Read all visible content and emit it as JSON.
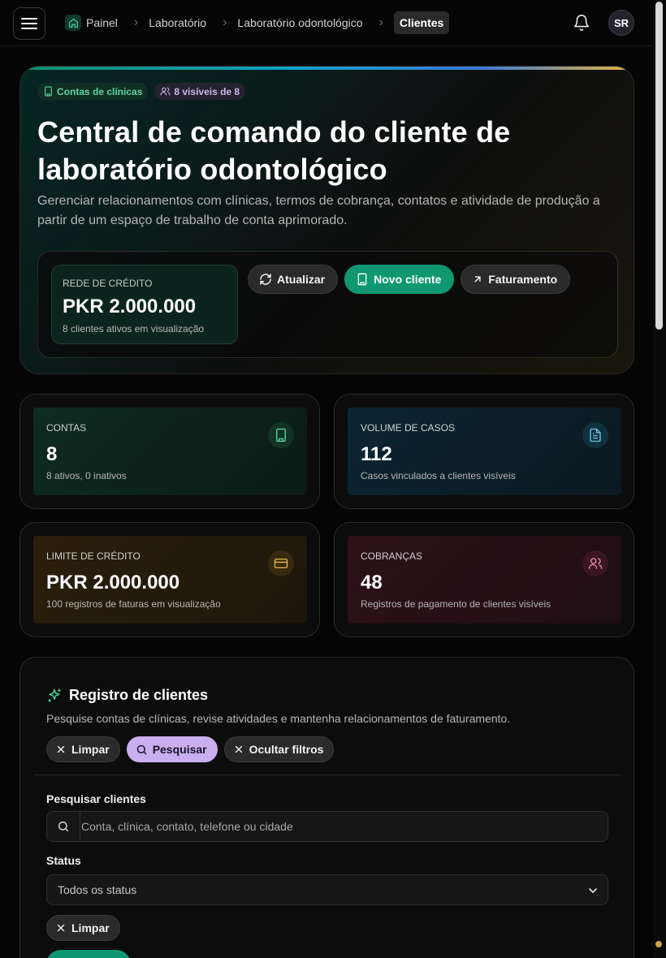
{
  "topbar": {
    "breadcrumbs": [
      "Painel",
      "Laboratório",
      "Laboratório odontológico",
      "Clientes"
    ],
    "avatar_initials": "SR"
  },
  "hero": {
    "chip_accounts": "Contas de clínicas",
    "chip_visible": "8 visíveis de 8",
    "title": "Central de comando do cliente de laboratório odontológico",
    "description": "Gerenciar relacionamentos com clínicas, termos de cobrança, contatos e atividade de produção a partir de um espaço de trabalho de conta aprimorado.",
    "credit": {
      "label": "Rede de crédito",
      "value": "PKR 2.000.000",
      "sub": "8 clientes ativos em visualização"
    },
    "actions": {
      "refresh": "Atualizar",
      "new_client": "Novo cliente",
      "billing": "Faturamento"
    }
  },
  "stats": [
    {
      "label": "Contas",
      "value": "8",
      "sub": "8 ativos, 0 inativos",
      "icon": "building-icon",
      "color": "#5fd6a2"
    },
    {
      "label": "Volume de casos",
      "value": "112",
      "sub": "Casos vinculados a clientes visíveis",
      "icon": "file-text-icon",
      "color": "#6cc6ec"
    },
    {
      "label": "Limite de crédito",
      "value": "PKR 2.000.000",
      "sub": "100 registros de faturas em visualização",
      "icon": "credit-card-icon",
      "color": "#e7b84a"
    },
    {
      "label": "Cobranças",
      "value": "48",
      "sub": "Registros de pagamento de clientes visíveis",
      "icon": "users-icon",
      "color": "#e88fa4"
    }
  ],
  "registry": {
    "title": "Registro de clientes",
    "description": "Pesquise contas de clínicas, revise atividades e mantenha relacionamentos de faturamento.",
    "actions": {
      "clear": "Limpar",
      "search": "Pesquisar",
      "hide_filters": "Ocultar filtros"
    },
    "search_label": "Pesquisar clientes",
    "search_placeholder": "Conta, clínica, contato, telefone ou cidade",
    "status_label": "Status",
    "status_value": "Todos os status",
    "clear_bottom": "Limpar"
  },
  "colors": {
    "accent_green": "#0f9870",
    "accent_purple": "#c9aef0"
  }
}
